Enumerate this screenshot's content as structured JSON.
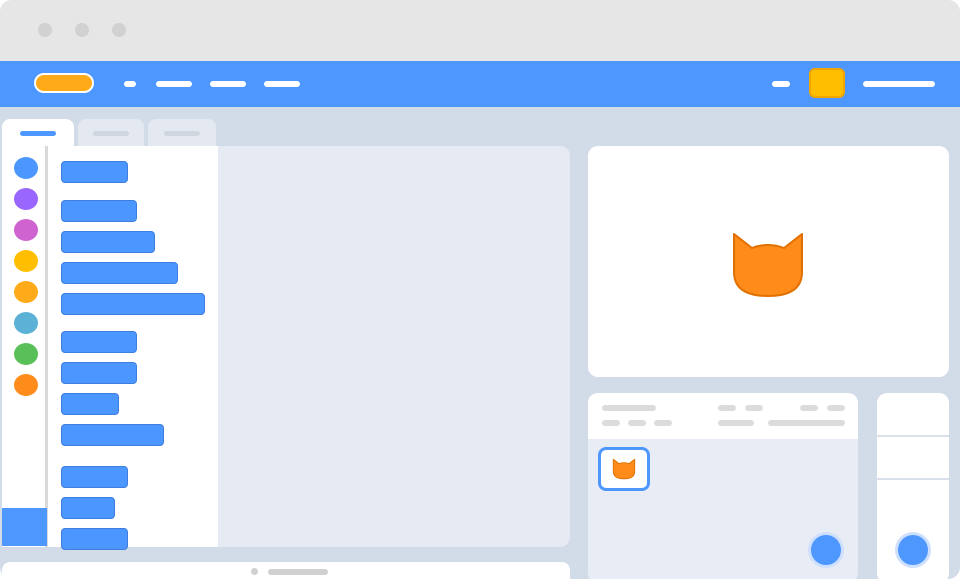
{
  "window": {
    "controls": [
      "close-dot",
      "minimize-dot",
      "maximize-dot"
    ]
  },
  "menubar": {
    "logo_color": "#ffab19",
    "accent_color": "#ffbf00",
    "background_color": "#4d97ff"
  },
  "tabs": [
    {
      "id": "code",
      "selected": true
    },
    {
      "id": "costumes",
      "selected": false
    },
    {
      "id": "sounds",
      "selected": false
    }
  ],
  "categories": [
    {
      "id": "motion",
      "color": "#4c97ff"
    },
    {
      "id": "looks",
      "color": "#9966ff"
    },
    {
      "id": "sound",
      "color": "#cf63cf"
    },
    {
      "id": "events",
      "color": "#ffbf00"
    },
    {
      "id": "control",
      "color": "#ffab19"
    },
    {
      "id": "sensing",
      "color": "#5cb1d6"
    },
    {
      "id": "operators",
      "color": "#59c059"
    },
    {
      "id": "variables",
      "color": "#ff8c1a"
    }
  ],
  "colors": {
    "block_blue": "#4c97ff",
    "sprite_orange": "#ff8c1a",
    "panel_bg": "#d2dbe8"
  },
  "stage": {
    "sprite_icon": "cat-icon"
  },
  "sprite_panel": {
    "selected_sprite_icon": "cat-icon"
  }
}
